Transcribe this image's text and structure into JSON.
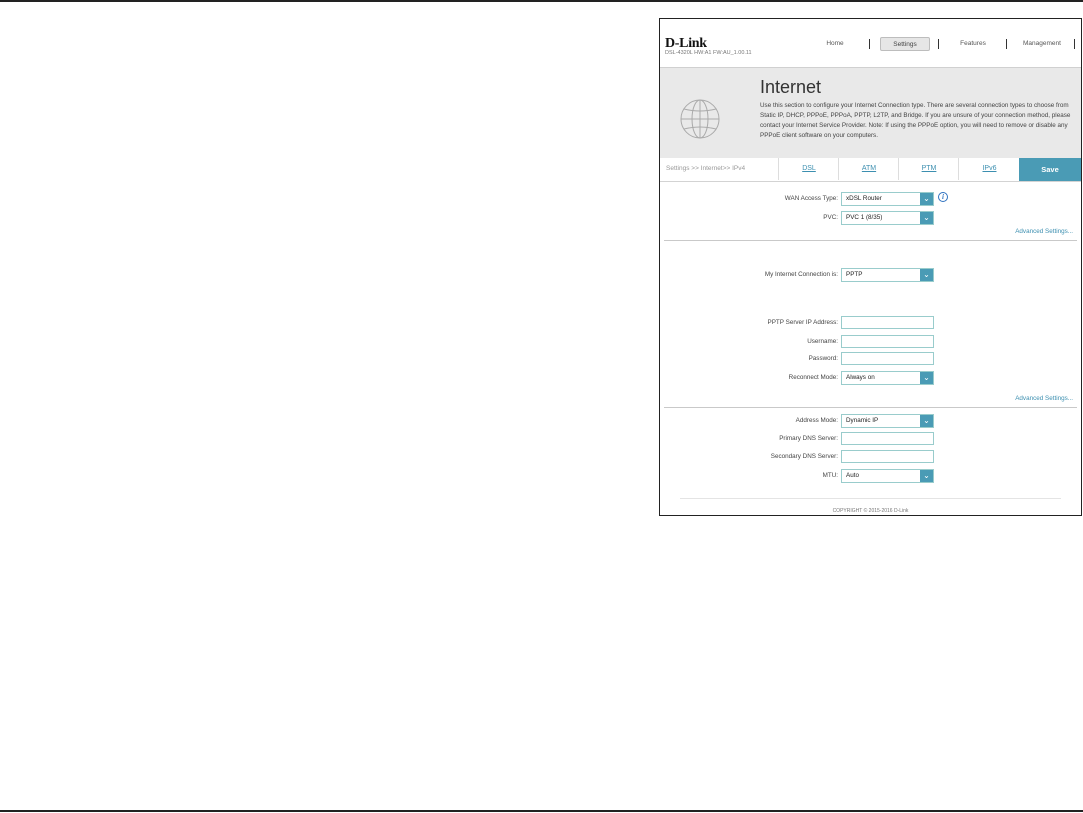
{
  "brand": "D-Link",
  "model_line": "DSL-4320L   HW:A1   FW:AU_1.00.11",
  "nav": [
    "Home",
    "Settings",
    "Features",
    "Management"
  ],
  "page": {
    "title": "Internet",
    "description": "Use this section to configure your Internet Connection type. There are several connection types to choose from Static IP, DHCP, PPPoE, PPPoA, PPTP, L2TP, and Bridge. If you are unsure of your connection method, please contact your Internet Service Provider. Note: If using the PPPoE option, you will need to remove or disable any PPPoE client software on your computers."
  },
  "breadcrumb": "Settings >> Internet>> IPv4",
  "tabs": [
    "DSL",
    "ATM",
    "PTM",
    "IPv6"
  ],
  "save_label": "Save",
  "wan": {
    "access_type_label": "WAN Access Type:",
    "access_type_value": "xDSL Router",
    "pvc_label": "PVC:",
    "pvc_value": "PVC 1 (8/35)",
    "advanced_link": "Advanced Settings..."
  },
  "connection": {
    "label": "My Internet Connection is:",
    "value": "PPTP",
    "server_label": "PPTP Server IP Address:",
    "server_value": "",
    "username_label": "Username:",
    "username_value": "",
    "password_label": "Password:",
    "password_value": "",
    "reconnect_label": "Reconnect Mode:",
    "reconnect_value": "Always on",
    "advanced_link": "Advanced Settings..."
  },
  "address": {
    "mode_label": "Address Mode:",
    "mode_value": "Dynamic IP",
    "dns1_label": "Primary DNS Server:",
    "dns1_value": "",
    "dns2_label": "Secondary DNS Server:",
    "dns2_value": "",
    "mtu_label": "MTU:",
    "mtu_value": "Auto"
  },
  "copyright": "COPYRIGHT © 2015-2016 D-Link",
  "icons": {
    "info": "info-icon",
    "dropdown": "chevron-down-icon",
    "globe": "globe-icon"
  },
  "accent_color": "#4a9bb5"
}
